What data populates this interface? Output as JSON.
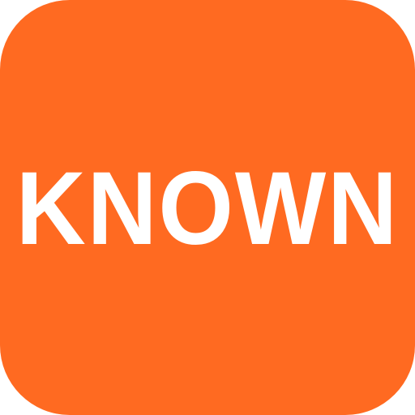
{
  "app_icon": {
    "label": "KNOWN",
    "background_color": "#FF6A21",
    "text_color": "#FFFFFF"
  }
}
